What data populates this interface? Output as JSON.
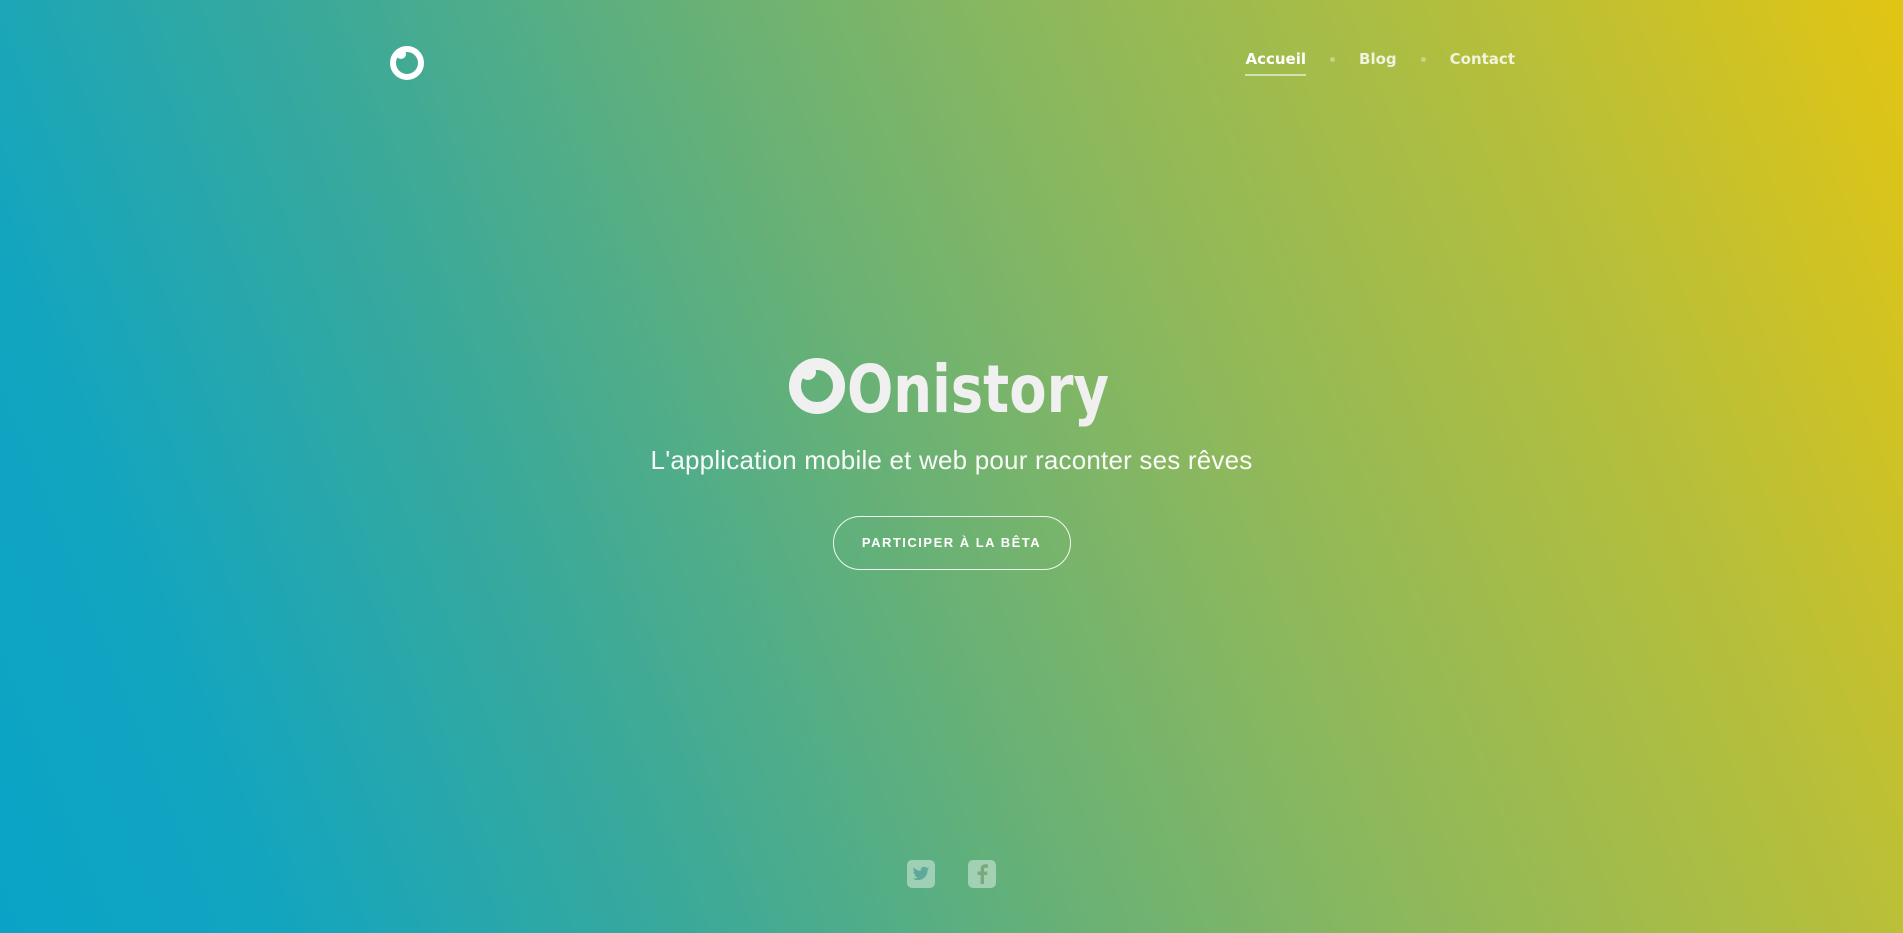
{
  "nav": {
    "items": [
      {
        "label": "Accueil",
        "active": true
      },
      {
        "label": "Blog",
        "active": false
      },
      {
        "label": "Contact",
        "active": false
      }
    ]
  },
  "hero": {
    "brand": "Onistory",
    "tagline": "L'application mobile et web pour raconter ses rêves",
    "cta_label": "PARTICIPER À LA BÊTA"
  },
  "social": [
    {
      "icon": "twitter-icon"
    },
    {
      "icon": "facebook-icon"
    }
  ],
  "colors": {
    "gradient_start": "#0aa3c7",
    "gradient_end": "#e2c513",
    "text": "#ffffff"
  }
}
